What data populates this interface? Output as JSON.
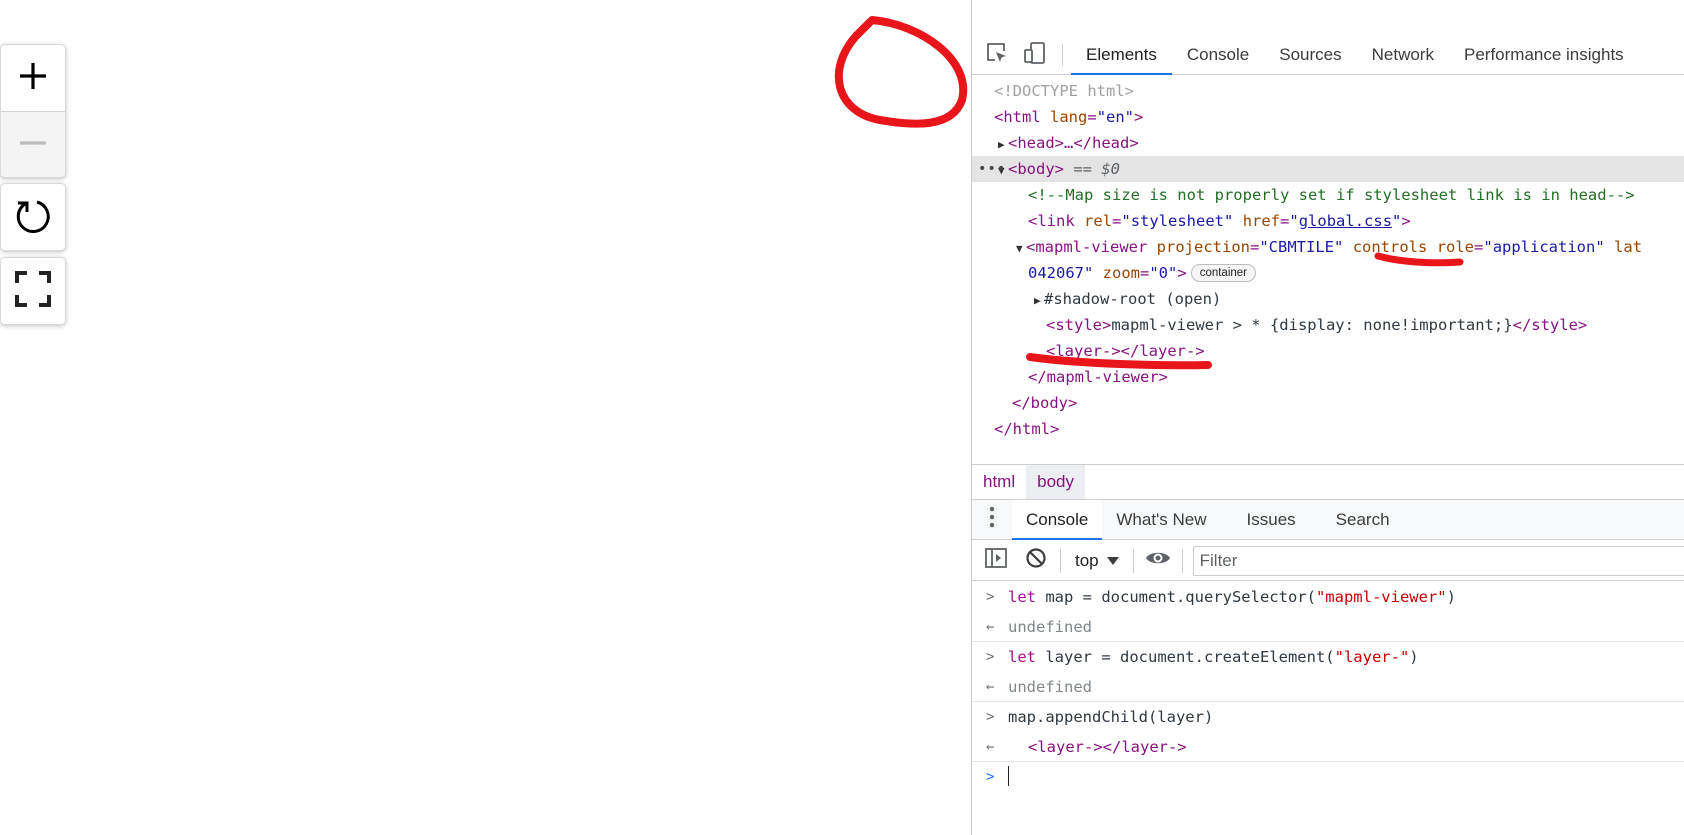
{
  "map_controls": {
    "zoom_in": "+",
    "zoom_out": "—",
    "reload": "↺",
    "fullscreen": "⛶"
  },
  "devtools": {
    "tabs": [
      "Elements",
      "Console",
      "Sources",
      "Network",
      "Performance insights"
    ],
    "active_tab": "Elements",
    "dom": {
      "doctype": "<!DOCTYPE html>",
      "html_open_tag": "<html",
      "html_lang_attr": "lang",
      "html_lang_eq": "=",
      "html_lang_val": "\"en\"",
      "html_open_close": ">",
      "head_collapsed": "<head>…</head>",
      "body_open": "<body>",
      "body_eq_dollar": "== $0",
      "comment": "<!--Map size is not properly set if stylesheet link is in head-->",
      "link_open": "<link",
      "link_rel_attr": "rel",
      "link_rel_val": "\"stylesheet\"",
      "link_href_attr": "href",
      "link_href_val": "global.css",
      "link_close": ">",
      "viewer_open": "<mapml-viewer",
      "viewer_proj_attr": "projection",
      "viewer_proj_val": "\"CBMTILE\"",
      "viewer_controls_attr": "controls",
      "viewer_role_attr": "role",
      "viewer_role_val": "\"application\"",
      "viewer_lat_attr": "lat",
      "viewer_line2_val": "042067\"",
      "viewer_zoom_attr": "zoom",
      "viewer_zoom_val": "\"0\"",
      "viewer_close_bracket": ">",
      "viewer_badge": "container",
      "shadow_root": "#shadow-root (open)",
      "style_open": "<style>",
      "style_text": "mapml-viewer > * {display: none!important;}",
      "style_close": "</style>",
      "layer_element": "<layer-></layer->",
      "viewer_close": "</mapml-viewer>",
      "body_close": "</body>",
      "html_close": "</html>"
    },
    "breadcrumbs": [
      "html",
      "body"
    ],
    "drawer_tabs": [
      "Console",
      "What's New",
      "Issues",
      "Search"
    ],
    "active_drawer_tab": "Console",
    "console_context": "top",
    "filter_placeholder": "Filter",
    "console": {
      "in1_kw": "let",
      "in1_mid": " map = document.querySelector(",
      "in1_str": "\"mapml-viewer\"",
      "in1_end": ")",
      "out1": "undefined",
      "in2_kw": "let",
      "in2_mid": " layer = document.createElement(",
      "in2_str": "\"layer-\"",
      "in2_end": ")",
      "out2": "undefined",
      "in3": "map.appendChild(layer)",
      "out3": "<layer-></layer->"
    }
  },
  "colors": {
    "accent": "#1a73e8",
    "annotation": "#e8161b",
    "tag": "#881280",
    "attr": "#994500",
    "value": "#1a1aa6"
  },
  "icons": [
    "plus-icon",
    "minus-icon",
    "reload-icon",
    "fullscreen-icon",
    "inspect-icon",
    "device-toolbar-icon",
    "kebab-menu-icon",
    "sidebar-toggle-icon",
    "clear-console-icon",
    "eye-icon",
    "dropdown-arrow-icon"
  ]
}
